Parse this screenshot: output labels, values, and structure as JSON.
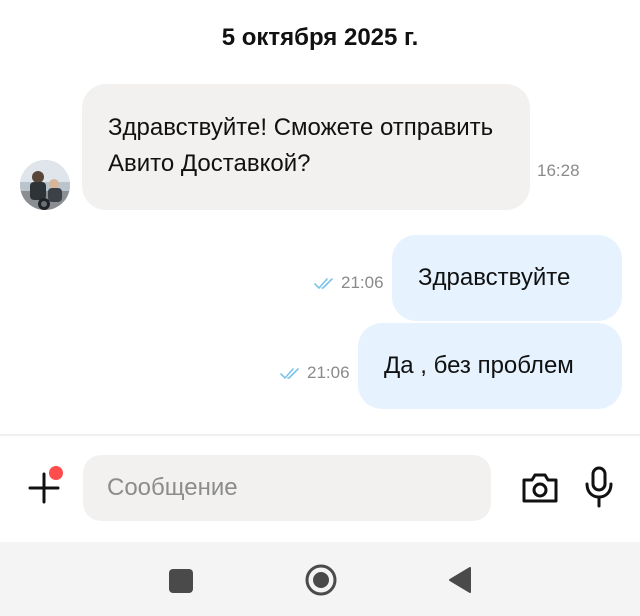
{
  "chat": {
    "date_header": "5 октября 2025 г.",
    "messages": [
      {
        "direction": "incoming",
        "text": "Здравствуйте! Сможете отправить Авито Доставкой?",
        "time": "16:28"
      },
      {
        "direction": "outgoing",
        "text": "Здравствуйте",
        "time": "21:06",
        "status_icon": "double-check-icon"
      },
      {
        "direction": "outgoing",
        "text": "Да , без проблем",
        "time": "21:06",
        "status_icon": "double-check-icon"
      }
    ]
  },
  "composer": {
    "placeholder": "Сообщение",
    "value": "",
    "icons": [
      "plus-icon",
      "camera-icon",
      "microphone-icon"
    ]
  },
  "navbar": {
    "icons": [
      "recent-apps-icon",
      "home-icon",
      "back-icon"
    ]
  },
  "colors": {
    "incoming_bubble": "#f2f1f0",
    "outgoing_bubble": "#e6f3ff",
    "read_check": "#7ec4ea",
    "notification_dot": "#ff4c4c",
    "navbar_background": "#f4f4f4"
  }
}
